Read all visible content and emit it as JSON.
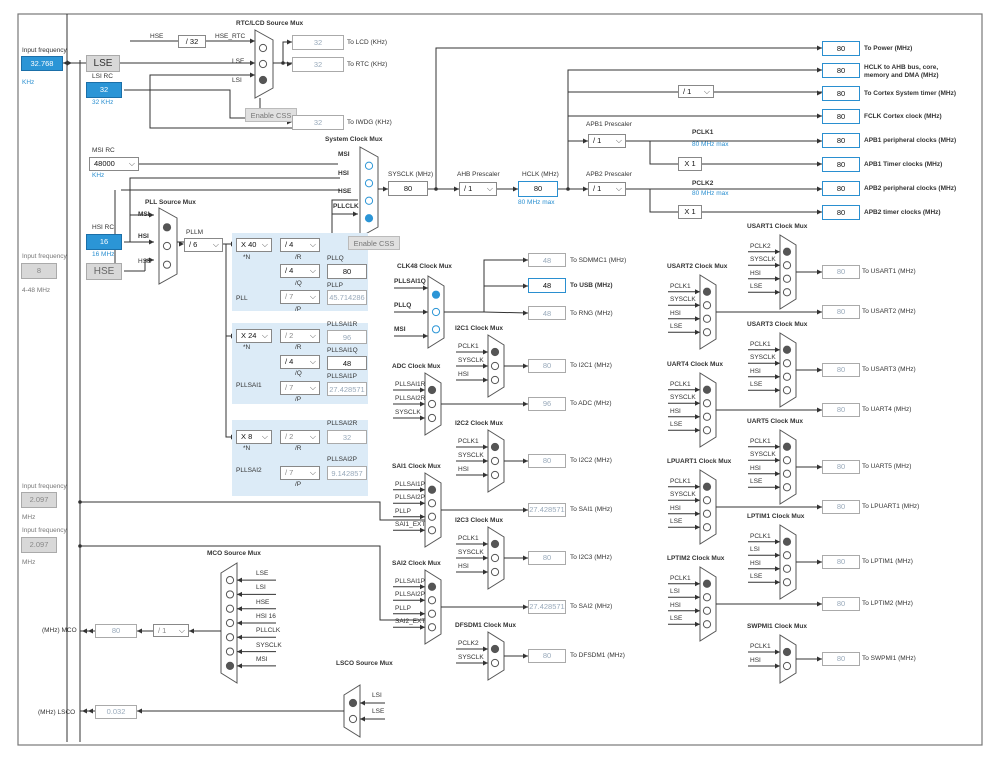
{
  "left_panel": {
    "input_frequency_label": "Input frequency",
    "lse_value": "32.768",
    "lse_unit": "KHz",
    "lse_label": "LSE",
    "lsi_label": "LSI RC",
    "lsi_value": "32",
    "lsi_unit": "32 KHz",
    "msi_label": "MSI RC",
    "msi_value": "48000",
    "msi_unit": "KHz",
    "hsi_label": "HSI RC",
    "hsi_value": "16",
    "hsi_unit": "16 MHz",
    "hse_input_value": "8",
    "hse_range": "4-48 MHz",
    "hse_label": "HSE",
    "ext1_value": "2.097",
    "ext1_unit": "MHz",
    "ext2_value": "2.097",
    "ext2_unit": "MHz",
    "mco_label": "(MHz) MCO",
    "mco_value": "80",
    "mco_div": "/ 1",
    "lsco_label": "(MHz) LSCO",
    "lsco_value": "0.032"
  },
  "rtc": {
    "mux_title": "RTC/LCD Source Mux",
    "hse_label": "HSE",
    "hse_div": "/ 32",
    "hse_rtc": "HSE_RTC",
    "lse": "LSE",
    "lsi": "LSI",
    "lcd_value": "32",
    "lcd_label": "To LCD (KHz)",
    "rtc_value": "32",
    "rtc_label": "To RTC (KHz)",
    "css_label": "Enable CSS",
    "iwdg_value": "32",
    "iwdg_label": "To IWDG (KHz)"
  },
  "sysmux": {
    "title": "System Clock Mux",
    "inputs": [
      "MSI",
      "HSI",
      "HSE",
      "PLLCLK"
    ],
    "css_label": "Enable CSS",
    "sysclk_label": "SYSCLK (MHz)",
    "sysclk_value": "80",
    "ahb_label": "AHB Prescaler",
    "ahb_value": "/ 1",
    "hclk_label": "HCLK (MHz)",
    "hclk_value": "80",
    "hclk_max": "80 MHz max"
  },
  "pll": {
    "mux_title": "PLL Source Mux",
    "inputs": [
      "MSI",
      "HSI",
      "HSE"
    ],
    "pllm_label": "PLLM",
    "pllm_value": "/ 6",
    "pll_n": "X 40",
    "pll_r": "/ 4",
    "pll_q": "/ 4",
    "pll_p": "/ 7",
    "n_label": "*N",
    "r_label": "/R",
    "q_label": "/Q",
    "p_label": "/P",
    "name": "PLL",
    "pllq_label": "PLLQ",
    "pllq_value": "80",
    "pllp_label": "PLLP",
    "pllp_value": "45.714286",
    "sai1_n": "X 24",
    "sai1_r": "/ 2",
    "sai1_q": "/ 4",
    "sai1_p": "/ 7",
    "sai1_name": "PLLSAI1",
    "sai1r_label": "PLLSAI1R",
    "sai1r_value": "96",
    "sai1q_label": "PLLSAI1Q",
    "sai1q_value": "48",
    "sai1p_label": "PLLSAI1P",
    "sai1p_value": "27.428571",
    "sai2_n": "X 8",
    "sai2_r": "/ 2",
    "sai2_p": "/ 7",
    "sai2_name": "PLLSAI2",
    "sai2r_label": "PLLSAI2R",
    "sai2r_value": "32",
    "sai2p_label": "PLLSAI2P",
    "sai2p_value": "9.142857"
  },
  "outputs": {
    "power_value": "80",
    "power_label": "To Power (MHz)",
    "hclk_ahb_value": "80",
    "hclk_ahb_label": "HCLK to AHB bus, core,",
    "hclk_ahb_label2": "memory and DMA (MHz)",
    "cortex_div": "/ 1",
    "cortex_value": "80",
    "cortex_label": "To Cortex System timer (MHz)",
    "fclk_value": "80",
    "fclk_label": "FCLK Cortex clock (MHz)",
    "apb1_prescaler_label": "APB1 Prescaler",
    "apb1_div": "/ 1",
    "pclk1_label": "PCLK1",
    "pclk1_max": "80 MHz max",
    "apb1_periph_value": "80",
    "apb1_periph_label": "APB1 peripheral clocks (MHz)",
    "apb1_timer_mult": "X 1",
    "apb1_timer_value": "80",
    "apb1_timer_label": "APB1 Timer clocks (MHz)",
    "apb2_prescaler_label": "APB2 Prescaler",
    "apb2_div": "/ 1",
    "pclk2_label": "PCLK2",
    "pclk2_max": "80 MHz max",
    "apb2_periph_value": "80",
    "apb2_periph_label": "APB2 peripheral clocks (MHz)",
    "apb2_timer_mult": "X 1",
    "apb2_timer_value": "80",
    "apb2_timer_label": "APB2 timer clocks (MHz)"
  },
  "clk48": {
    "title": "CLK48 Clock Mux",
    "inputs": [
      "PLLSAI1Q",
      "PLLQ",
      "MSI"
    ],
    "sdmmc_value": "48",
    "sdmmc_label": "To SDMMC1 (MHz)",
    "usb_value": "48",
    "usb_label": "To USB (MHz)",
    "rng_value": "48",
    "rng_label": "To RNG (MHz)"
  },
  "mid_muxes": [
    {
      "title": "I2C1 Clock Mux",
      "inputs": [
        "PCLK1",
        "SYSCLK",
        "HSI"
      ],
      "value": "80",
      "label": "To I2C1 (MHz)"
    },
    {
      "title": "ADC Clock Mux",
      "inputs": [
        "PLLSAI1R",
        "PLLSAI2R",
        "SYSCLK"
      ],
      "value": "96",
      "label": "To ADC (MHz)"
    },
    {
      "title": "I2C2 Clock Mux",
      "inputs": [
        "PCLK1",
        "SYSCLK",
        "HSI"
      ],
      "value": "80",
      "label": "To I2C2 (MHz)"
    },
    {
      "title": "SAI1 Clock Mux",
      "inputs": [
        "PLLSAI1P",
        "PLLSAI2P",
        "PLLP",
        "SAI1_EXT"
      ],
      "value": "27.428571",
      "label": "To SAI1 (MHz)"
    },
    {
      "title": "I2C3 Clock Mux",
      "inputs": [
        "PCLK1",
        "SYSCLK",
        "HSI"
      ],
      "value": "80",
      "label": "To I2C3 (MHz)"
    },
    {
      "title": "SAI2 Clock Mux",
      "inputs": [
        "PLLSAI1P",
        "PLLSAI2P",
        "PLLP",
        "SAI2_EXT"
      ],
      "value": "27.428571",
      "label": "To SAI2 (MHz)"
    },
    {
      "title": "DFSDM1 Clock Mux",
      "inputs": [
        "PCLK2",
        "SYSCLK"
      ],
      "value": "80",
      "label": "To DFSDM1 (MHz)"
    }
  ],
  "right_muxes": [
    {
      "title": "USART1 Clock Mux",
      "inputs": [
        "PCLK2",
        "SYSCLK",
        "HSI",
        "LSE"
      ],
      "value": "80",
      "label": "To USART1 (MHz)"
    },
    {
      "title": "USART2 Clock Mux",
      "inputs": [
        "PCLK1",
        "SYSCLK",
        "HSI",
        "LSE"
      ],
      "value": "80",
      "label": "To USART2 (MHz)"
    },
    {
      "title": "USART3 Clock Mux",
      "inputs": [
        "PCLK1",
        "SYSCLK",
        "HSI",
        "LSE"
      ],
      "value": "80",
      "label": "To USART3 (MHz)"
    },
    {
      "title": "UART4 Clock Mux",
      "inputs": [
        "PCLK1",
        "SYSCLK",
        "HSI",
        "LSE"
      ],
      "value": "80",
      "label": "To UART4 (MHz)"
    },
    {
      "title": "UART5 Clock Mux",
      "inputs": [
        "PCLK1",
        "SYSCLK",
        "HSI",
        "LSE"
      ],
      "value": "80",
      "label": "To UART5 (MHz)"
    },
    {
      "title": "LPUART1 Clock Mux",
      "inputs": [
        "PCLK1",
        "SYSCLK",
        "HSI",
        "LSE"
      ],
      "value": "80",
      "label": "To LPUART1 (MHz)"
    },
    {
      "title": "LPTIM1 Clock Mux",
      "inputs": [
        "PCLK1",
        "LSI",
        "HSI",
        "LSE"
      ],
      "value": "80",
      "label": "To LPTIM1 (MHz)"
    },
    {
      "title": "LPTIM2 Clock Mux",
      "inputs": [
        "PCLK1",
        "LSI",
        "HSI",
        "LSE"
      ],
      "value": "80",
      "label": "To LPTIM2 (MHz)"
    },
    {
      "title": "SWPMI1 Clock Mux",
      "inputs": [
        "PCLK1",
        "HSI"
      ],
      "value": "80",
      "label": "To SWPMI1 (MHz)"
    }
  ],
  "mco": {
    "title": "MCO Source Mux",
    "inputs": [
      "LSE",
      "LSI",
      "HSE",
      "HSI 16",
      "PLLCLK",
      "SYSCLK",
      "MSI"
    ]
  },
  "lsco": {
    "title": "LSCO Source Mux",
    "inputs": [
      "LSI",
      "LSE"
    ]
  },
  "colors": {
    "accent": "#2b95d6",
    "panel": "#dcebf7",
    "wire": "#333333"
  }
}
